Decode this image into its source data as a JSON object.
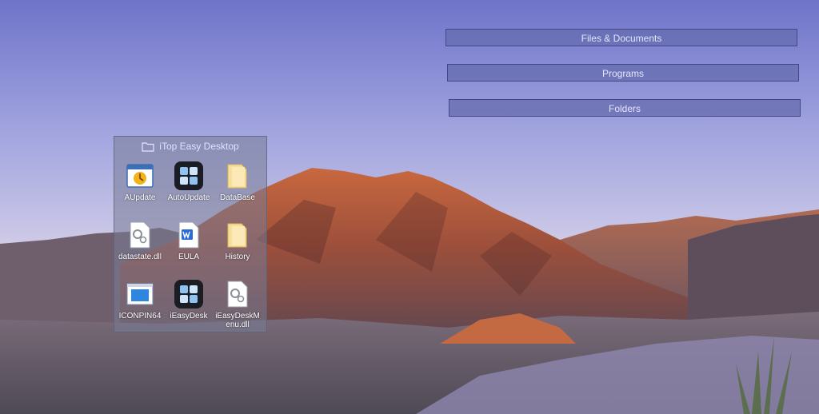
{
  "category_bars": {
    "files": "Files & Documents",
    "programs": "Programs",
    "folders": "Folders"
  },
  "fence": {
    "title": "iTop Easy Desktop",
    "items": [
      {
        "label": "AUpdate",
        "icon": "aupdate-app-icon"
      },
      {
        "label": "AutoUpdate",
        "icon": "autoupdate-app-icon"
      },
      {
        "label": "DataBase",
        "icon": "folder-icon"
      },
      {
        "label": "datastate.dll",
        "icon": "dll-file-icon"
      },
      {
        "label": "EULA",
        "icon": "word-document-icon"
      },
      {
        "label": "History",
        "icon": "folder-icon"
      },
      {
        "label": "ICONPIN64",
        "icon": "window-app-icon"
      },
      {
        "label": "iEasyDesk",
        "icon": "iEasyDesk-app-icon"
      },
      {
        "label": "iEasyDeskMenu.dll",
        "icon": "dll-file-icon"
      }
    ]
  },
  "colors": {
    "bar_fill": "#676db0",
    "sky_top": "#6f74c9",
    "mountain": "#b85a3a"
  }
}
